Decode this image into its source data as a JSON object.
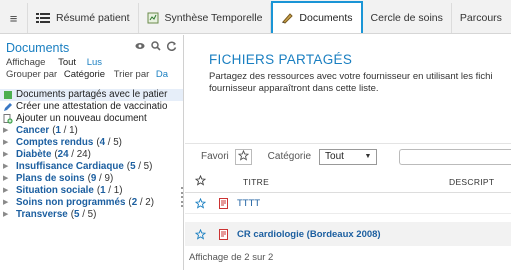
{
  "colors": {
    "accent": "#1a95d6",
    "link": "#1a7fc1",
    "category": "#1c5fa0",
    "pdf": "#d0312d"
  },
  "tabs": [
    {
      "icon": "menu-icon",
      "label": ""
    },
    {
      "icon": "grid-icon",
      "label": "Résumé patient"
    },
    {
      "icon": "timeline-icon",
      "label": "Synthèse Temporelle"
    },
    {
      "icon": "document-icon",
      "label": "Documents"
    },
    {
      "icon": "",
      "label": "Cercle de soins"
    },
    {
      "icon": "",
      "label": "Parcours"
    }
  ],
  "sidebar": {
    "title": "Documents",
    "display_label": "Affichage",
    "display_all": "Tout",
    "display_read": "Lus",
    "group_label": "Grouper par",
    "group_value": "Catégorie",
    "sort_label": "Trier par",
    "sort_value": "Da",
    "doc_items": [
      {
        "icon": "shared-docs-icon",
        "label": "Documents partagés avec le patier"
      },
      {
        "icon": "pencil-icon",
        "label": "Créer une attestation de vaccinatio"
      },
      {
        "icon": "add-document-icon",
        "label": "Ajouter un nouveau document"
      }
    ],
    "categories": [
      {
        "name": "Cancer",
        "open": "(",
        "count": "1",
        "total": " / 1)"
      },
      {
        "name": "Comptes rendus",
        "open": "(",
        "count": "4",
        "total": " / 5)"
      },
      {
        "name": "Diabète",
        "open": "(",
        "count": "24",
        "total": " / 24)"
      },
      {
        "name": "Insuffisance Cardiaque",
        "open": "(",
        "count": "5",
        "total": " / 5)"
      },
      {
        "name": "Plans de soins",
        "open": "(",
        "count": "9",
        "total": " / 9)"
      },
      {
        "name": "Situation sociale",
        "open": "(",
        "count": "1",
        "total": " / 1)"
      },
      {
        "name": "Soins non programmés",
        "open": "(",
        "count": "2",
        "total": " / 2)"
      },
      {
        "name": "Transverse",
        "open": "(",
        "count": "5",
        "total": " / 5)"
      }
    ]
  },
  "main": {
    "title": "FICHIERS PARTAGÉS",
    "desc_line1": "Partagez des ressources avec votre fournisseur en utilisant les fichi",
    "desc_line2": "fournisseur apparaîtront dans cette liste.",
    "favorite_label": "Favori",
    "category_label": "Catégorie",
    "category_value": "Tout",
    "table_headers": {
      "title": "TITRE",
      "description": "DESCRIPT"
    },
    "rows": [
      {
        "title": "TTTT"
      },
      {
        "title": "CR cardiologie (Bordeaux 2008)"
      }
    ],
    "footer": "Affichage de 2 sur 2"
  }
}
